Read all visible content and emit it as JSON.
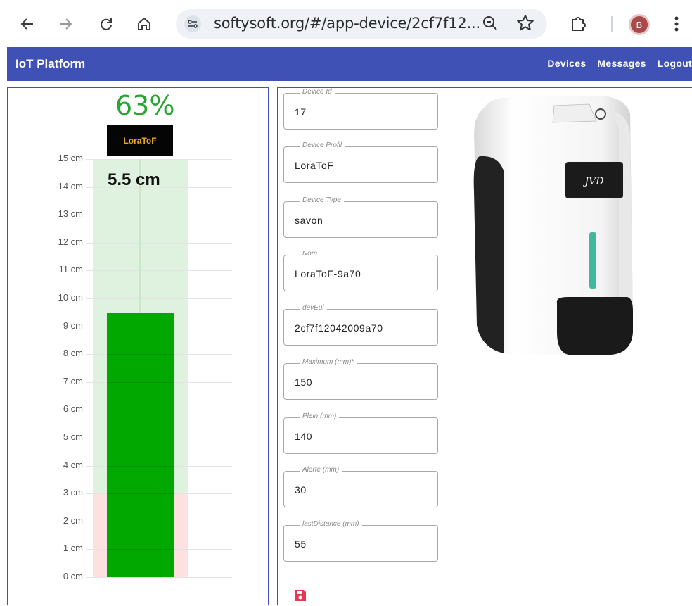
{
  "browser": {
    "url": "softysoft.org/#/app-device/2cf7f12...",
    "avatar_letter": "B",
    "icons": [
      "back-arrow-icon",
      "forward-arrow-icon",
      "reload-icon",
      "home-icon",
      "site-settings-icon",
      "zoom-icon",
      "bookmark-star-icon",
      "extensions-icon",
      "kebab-menu-icon"
    ]
  },
  "appbar": {
    "brand": "IoT Platform",
    "links": [
      "Devices",
      "Messages",
      "Logout"
    ],
    "color": "#3f51b5"
  },
  "gauge": {
    "percent_label": "63%",
    "profile_badge": "LoraToF",
    "distance_label": "5.5 cm",
    "axis_ticks": [
      "15 cm",
      "14 cm",
      "13 cm",
      "12 cm",
      "11 cm",
      "10 cm",
      "9 cm",
      "8 cm",
      "7 cm",
      "6 cm",
      "5 cm",
      "4 cm",
      "3 cm",
      "2 cm",
      "1 cm",
      "0 cm"
    ],
    "max_cm": 15,
    "level_cm": 9.5,
    "alert_cm": 3,
    "colors": {
      "level": "#00a800",
      "background": "#dff2df",
      "alert_zone": "#fde0e0",
      "percent": "#26a62e"
    }
  },
  "form": {
    "fields": [
      {
        "label": "Device Id",
        "value": "17"
      },
      {
        "label": "Device Profil",
        "value": "LoraToF"
      },
      {
        "label": "Device Type",
        "value": "savon"
      },
      {
        "label": "Nom",
        "value": "LoraToF-9a70"
      },
      {
        "label": "devEui",
        "value": "2cf7f12042009a70"
      },
      {
        "label": "Maximum (mm)*",
        "value": "150"
      },
      {
        "label": "Plein (mm)",
        "value": "140"
      },
      {
        "label": "Alerte (mm)",
        "value": "30"
      },
      {
        "label": "lastDistance (mm)",
        "value": "55"
      }
    ],
    "save_icon": "save-icon",
    "save_color": "#e53950"
  },
  "product_image": {
    "brand_text": "JVD"
  }
}
